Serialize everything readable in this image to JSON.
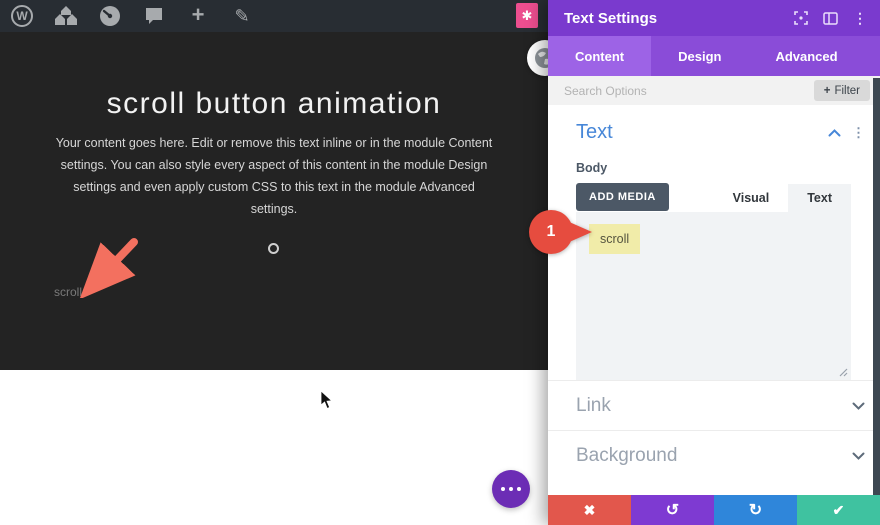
{
  "colors": {
    "panel_header_purple": "#7a3ace",
    "panel_tabbar_purple": "#8a4cd8",
    "panel_tab_active_purple": "#9d63e6",
    "section_title_blue": "#4787d8",
    "discard_red": "#e2574c",
    "undo_purple": "#7e3ad2",
    "redo_blue": "#2f86da",
    "save_teal": "#3fc2a0",
    "annotation_red": "#e64c3f",
    "highlight_yellow": "#f1eca9",
    "divi_pink": "#ec4e8f",
    "canvas_dark": "#232323",
    "admin_bar_dark": "#282d33"
  },
  "admin_bar": {
    "wordpress_label": "W",
    "plus_icon": "+",
    "pencil_icon": "✎",
    "divi_icon": "✱"
  },
  "canvas": {
    "heading": "scroll button animation",
    "body_text": "Your content goes here. Edit or remove this text inline or in the module Content settings. You can also style every aspect of this content in the module Design settings and even apply custom CSS to this text in the module Advanced settings.",
    "scroll_label": "scroll"
  },
  "annotation": {
    "step": "1"
  },
  "panel": {
    "title": "Text Settings",
    "header_menu_dots": "⋮",
    "tabs": [
      {
        "label": "Content",
        "active": true
      },
      {
        "label": "Design",
        "active": false
      },
      {
        "label": "Advanced",
        "active": false
      }
    ],
    "search": {
      "placeholder": "Search Options",
      "plus": "+",
      "filter_label": "Filter"
    },
    "text_section": {
      "title": "Text",
      "menu_dots": "⋮",
      "field_label": "Body",
      "add_media_label": "ADD MEDIA",
      "editor_tabs": [
        {
          "label": "Visual",
          "active": false
        },
        {
          "label": "Text",
          "active": true
        }
      ],
      "content": "scroll"
    },
    "link_section": {
      "title": "Link"
    },
    "background_section": {
      "title": "Background"
    },
    "actions": [
      {
        "name": "discard",
        "icon": "✖"
      },
      {
        "name": "undo",
        "icon": "↺"
      },
      {
        "name": "redo",
        "icon": "↻"
      },
      {
        "name": "save",
        "icon": "✔"
      }
    ]
  }
}
